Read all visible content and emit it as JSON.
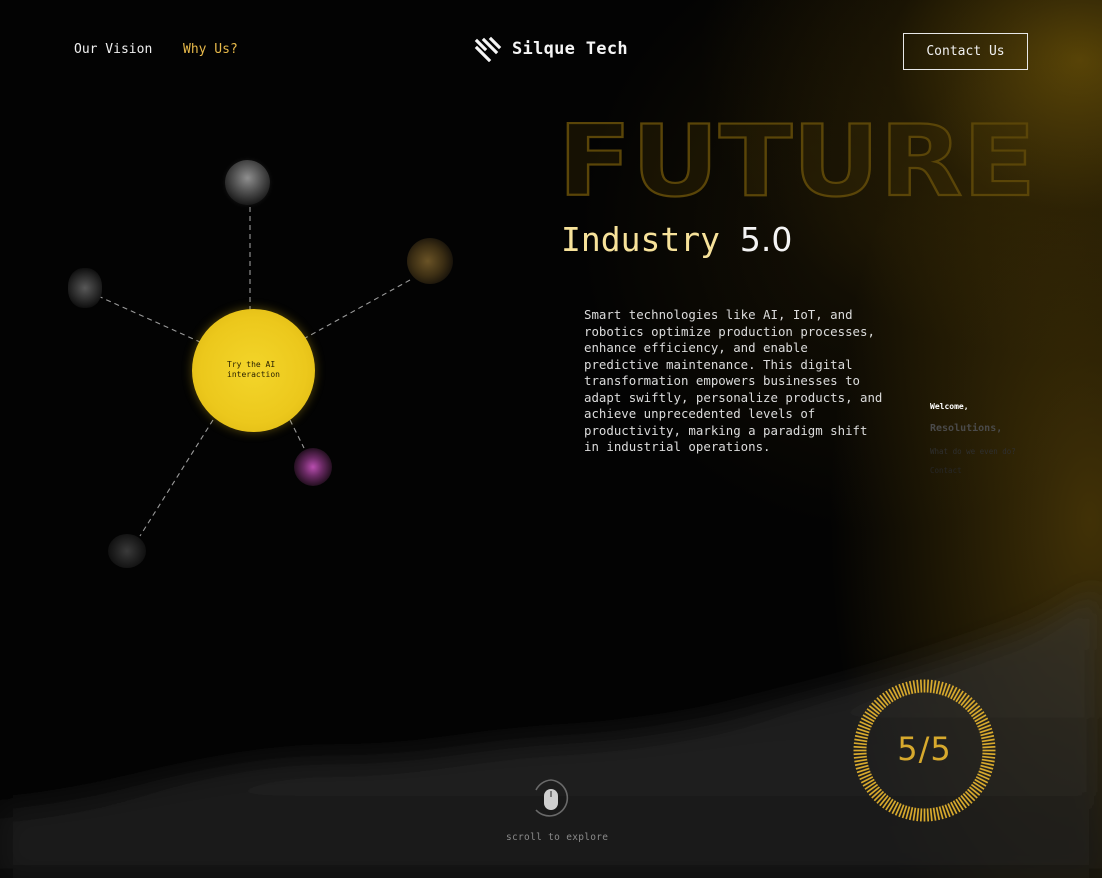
{
  "nav": {
    "vision_label": "Our Vision",
    "why_label": "Why Us?",
    "brand": "Silque Tech",
    "contact_label": "Contact Us"
  },
  "hero": {
    "outline_word": "FUTURE",
    "industry_word": "Industry",
    "industry_version": "5.0",
    "description": "Smart technologies like AI, IoT, and robotics optimize production processes, enhance efficiency, and enable predictive maintenance. This digital transformation empowers businesses to adapt swiftly, personalize products, and achieve unprecedented levels of productivity, marking a paradigm shift in industrial operations."
  },
  "orbit": {
    "core_label_line1": "Try the AI",
    "core_label_line2": "interaction"
  },
  "side_menu": {
    "items": [
      "Welcome,",
      "Resolutions,",
      "What do we even do?",
      "Contact"
    ]
  },
  "footer": {
    "scroll_label": "scroll to explore",
    "counter": "5/5"
  },
  "colors": {
    "accent": "#e7b94a",
    "core": "#ecc81c",
    "outline": "#5a4508",
    "counter": "#d7a92d"
  },
  "icons": {
    "logo": "slash-stripes-icon",
    "scroll": "mouse-icon"
  }
}
